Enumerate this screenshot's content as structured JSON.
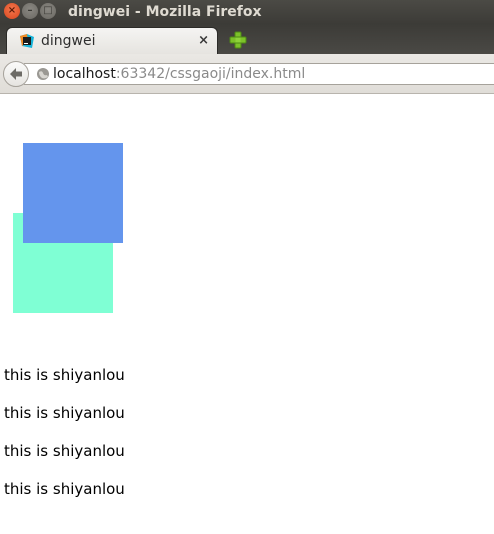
{
  "window": {
    "title": "dingwei - Mozilla Firefox",
    "close_glyph": "×",
    "minimize_glyph": "–",
    "maximize_glyph": "□"
  },
  "tab": {
    "label": "dingwei",
    "close_glyph": "×",
    "favicon": "webstorm-icon"
  },
  "newtab": {
    "icon": "plus-icon",
    "color": "#7cc22a"
  },
  "navbar": {
    "back_icon": "back-arrow-icon",
    "site_icon": "globe-icon",
    "url_host": "localhost",
    "url_rest": ":63342/cssgaoji/index.html"
  },
  "page": {
    "boxes": [
      {
        "name": "blue-box",
        "color": "#6495ed"
      },
      {
        "name": "green-box",
        "color": "#7fffd4"
      }
    ],
    "paragraphs": [
      "this is shiyanlou",
      "this is shiyanlou",
      "this is shiyanlou",
      "this is shiyanlou"
    ]
  }
}
